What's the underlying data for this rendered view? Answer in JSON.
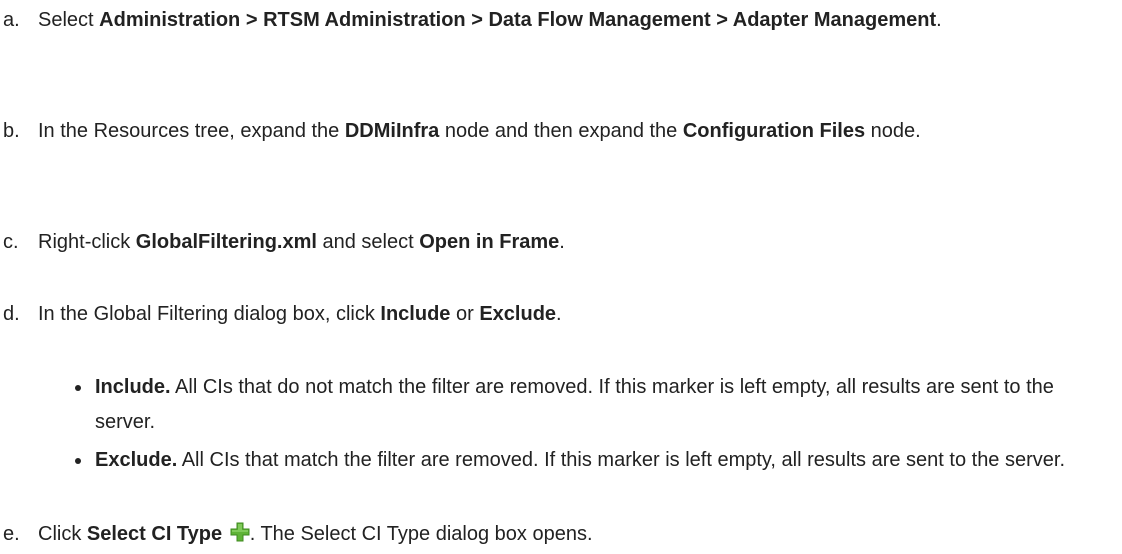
{
  "steps": [
    {
      "marker": "a.",
      "segments": [
        {
          "text": "Select ",
          "bold": false
        },
        {
          "text": "Administration > RTSM Administration > Data Flow Management > Adapter Management",
          "bold": true
        },
        {
          "text": ".",
          "bold": false
        }
      ]
    },
    {
      "marker": "b.",
      "segments": [
        {
          "text": "In the Resources tree, expand the ",
          "bold": false
        },
        {
          "text": "DDMiInfra",
          "bold": true
        },
        {
          "text": " node and then expand the ",
          "bold": false
        },
        {
          "text": "Configuration Files",
          "bold": true
        },
        {
          "text": " node.",
          "bold": false
        }
      ]
    },
    {
      "marker": "c.",
      "segments": [
        {
          "text": "Right-click ",
          "bold": false
        },
        {
          "text": "GlobalFiltering.xml",
          "bold": true
        },
        {
          "text": " and select ",
          "bold": false
        },
        {
          "text": "Open in Frame",
          "bold": true
        },
        {
          "text": ".",
          "bold": false
        }
      ]
    },
    {
      "marker": "d.",
      "segments": [
        {
          "text": "In the Global Filtering dialog box, click ",
          "bold": false
        },
        {
          "text": "Include",
          "bold": true
        },
        {
          "text": " or ",
          "bold": false
        },
        {
          "text": "Exclude",
          "bold": true
        },
        {
          "text": ".",
          "bold": false
        }
      ]
    },
    {
      "marker": "e.",
      "segments": [
        {
          "text": "Click ",
          "bold": false
        },
        {
          "text": "Select CI Type",
          "bold": true
        },
        {
          "text": " ",
          "bold": false
        },
        {
          "text": ". The Select CI Type dialog box opens.",
          "bold": false
        }
      ],
      "icon": "green-plus-icon"
    }
  ],
  "bullets": [
    {
      "term": "Include.",
      "text": " All CIs that do not match the filter are removed. If this marker is left empty, all results are sent to the server."
    },
    {
      "term": "Exclude.",
      "text": " All CIs that match the filter are removed. If this marker is left empty, all results are sent to the server."
    }
  ],
  "colors": {
    "text": "#222222",
    "icon_green": "#5fb336"
  }
}
